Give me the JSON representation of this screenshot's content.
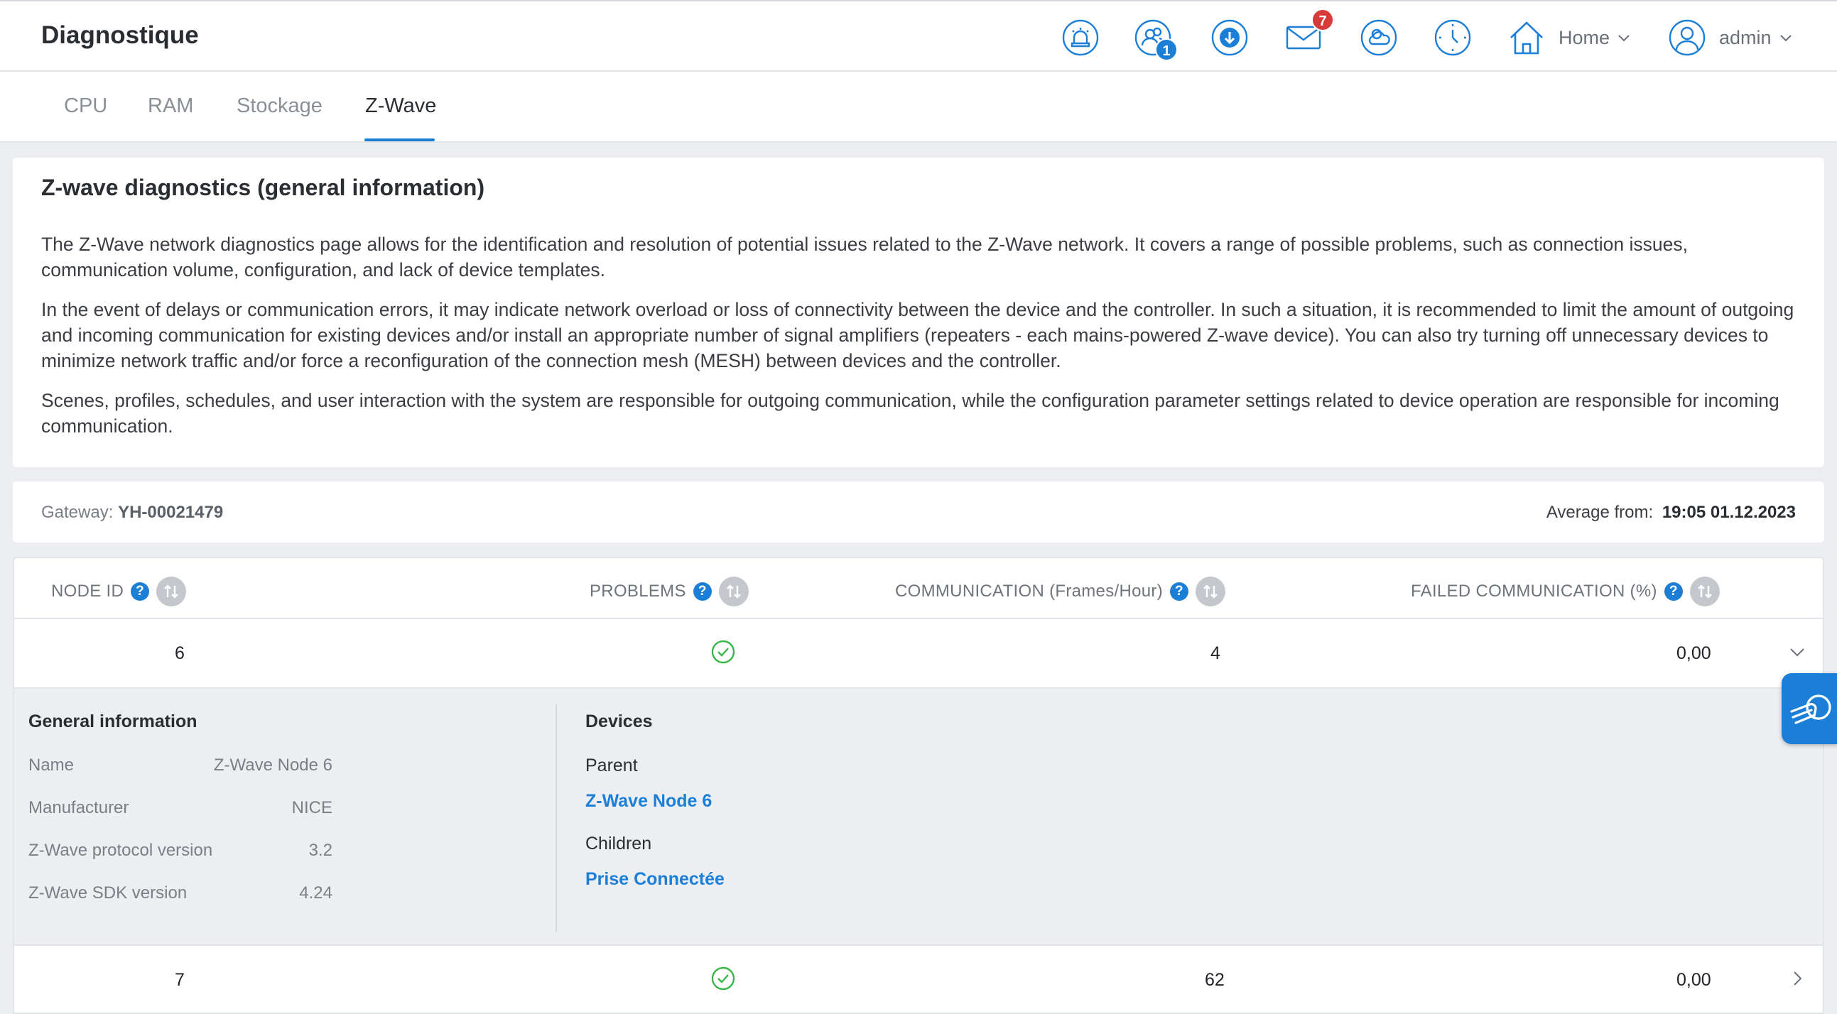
{
  "header": {
    "title": "Diagnostique",
    "icons": {
      "alarm": "alarm-icon",
      "users": "users-icon",
      "download": "download-icon",
      "mail": "mail-icon",
      "weather": "weather-icon",
      "clock": "clock-icon",
      "home": "home-icon",
      "user": "user-icon"
    },
    "users_badge": "1",
    "mail_badge": "7",
    "home_label": "Home",
    "user_label": "admin"
  },
  "tabs": [
    {
      "label": "CPU",
      "active": false
    },
    {
      "label": "RAM",
      "active": false
    },
    {
      "label": "Stockage",
      "active": false
    },
    {
      "label": "Z-Wave",
      "active": true
    }
  ],
  "info": {
    "title": "Z-wave diagnostics (general information)",
    "paragraphs": [
      "The Z-Wave network diagnostics page allows for the identification and resolution of potential issues related to the Z-Wave network. It covers a range of possible problems, such as connection issues, communication volume, configuration, and lack of device templates.",
      "In the event of delays or communication errors, it may indicate network overload or loss of connectivity between the device and the controller. In such a situation, it is recommended to limit the amount of outgoing and incoming communication for existing devices and/or install an appropriate number of signal amplifiers (repeaters - each mains-powered Z-wave device). You can also try turning off unnecessary devices to minimize network traffic and/or force a reconfiguration of the connection mesh (MESH) between devices and the controller.",
      "Scenes, profiles, schedules, and user interaction with the system are responsible for outgoing communication, while the configuration parameter settings related to device operation are responsible for incoming communication."
    ]
  },
  "gateway": {
    "label": "Gateway:",
    "value": "YH-00021479",
    "average_label": "Average from:",
    "average_value": "19:05 01.12.2023"
  },
  "table": {
    "columns": [
      "NODE ID",
      "PROBLEMS",
      "COMMUNICATION (Frames/Hour)",
      "FAILED COMMUNICATION (%)"
    ],
    "rows": [
      {
        "node_id": "6",
        "problems": "ok",
        "communication": "4",
        "failed": "0,00",
        "expanded": true
      },
      {
        "node_id": "7",
        "problems": "ok",
        "communication": "62",
        "failed": "0,00",
        "expanded": false
      }
    ],
    "detail": {
      "general_title": "General information",
      "fields": [
        {
          "label": "Name",
          "value": "Z-Wave Node 6"
        },
        {
          "label": "Manufacturer",
          "value": "NICE"
        },
        {
          "label": "Z-Wave protocol version",
          "value": "3.2"
        },
        {
          "label": "Z-Wave SDK version",
          "value": "4.24"
        }
      ],
      "devices_title": "Devices",
      "parent_label": "Parent",
      "parent_link": "Z-Wave Node 6",
      "children_label": "Children",
      "children_link": "Prise Connectée"
    }
  },
  "colors": {
    "accent": "#1b7fd8",
    "badge_red": "#d83a3a",
    "ok_green": "#3bb54a"
  },
  "float_help": {
    "icon": "help-hand-icon"
  }
}
